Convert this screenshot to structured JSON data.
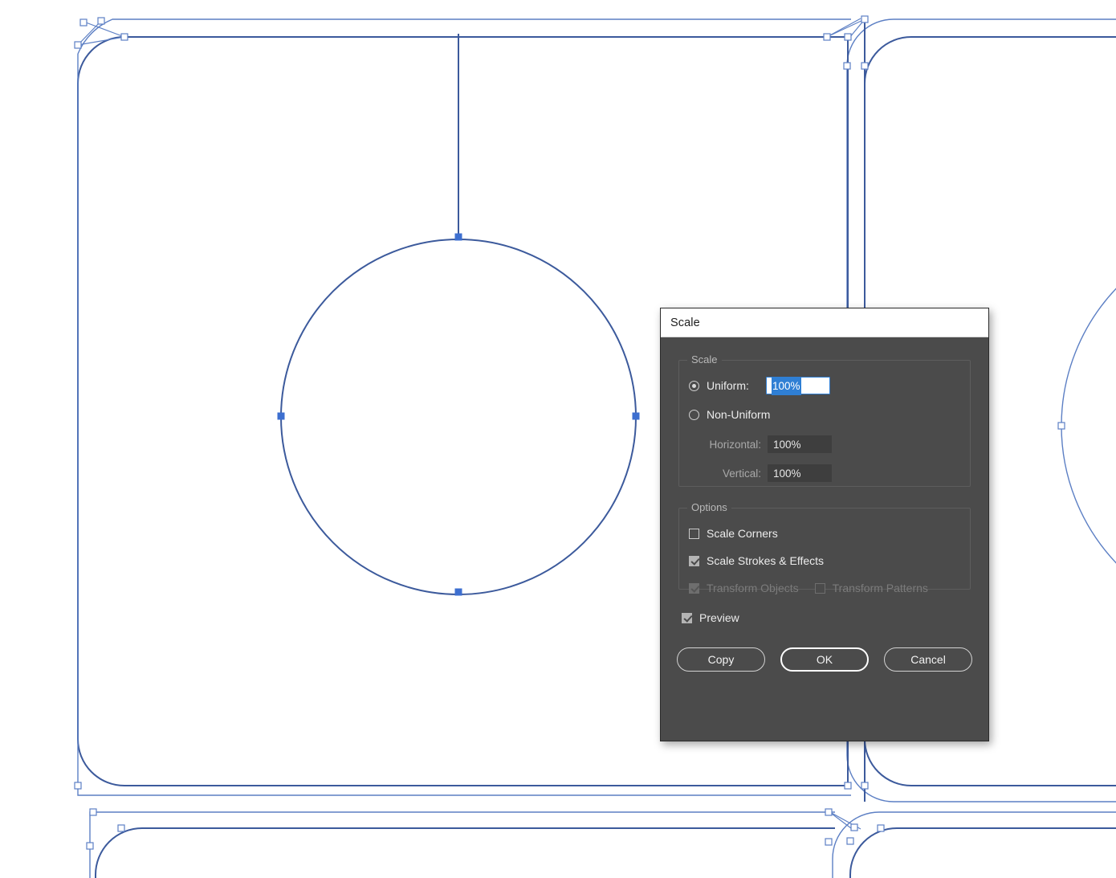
{
  "app": {
    "canvas_background": "#ffffff",
    "path_stroke_color": "#3c5a9c",
    "anchor_selected_color": "#3d6fd0",
    "anchor_unselected_fill": "#ffffff"
  },
  "dialog": {
    "title": "Scale",
    "groups": {
      "scale": {
        "legend": "Scale",
        "uniform": {
          "label": "Uniform:",
          "selected": true,
          "value": "100%"
        },
        "non_uniform": {
          "label": "Non-Uniform",
          "selected": false
        },
        "horizontal": {
          "label": "Horizontal:",
          "value": "100%",
          "enabled": false
        },
        "vertical": {
          "label": "Vertical:",
          "value": "100%",
          "enabled": false
        }
      },
      "options": {
        "legend": "Options",
        "items": [
          {
            "label": "Scale Corners",
            "checked": false,
            "enabled": true
          },
          {
            "label": "Scale Strokes & Effects",
            "checked": true,
            "enabled": true
          },
          {
            "label": "Transform Objects",
            "checked": true,
            "enabled": false
          },
          {
            "label": "Transform Patterns",
            "checked": false,
            "enabled": false
          }
        ]
      }
    },
    "preview": {
      "label": "Preview",
      "checked": true
    },
    "buttons": [
      {
        "label": "Copy",
        "default": false
      },
      {
        "label": "OK",
        "default": true
      },
      {
        "label": "Cancel",
        "default": false
      }
    ]
  }
}
